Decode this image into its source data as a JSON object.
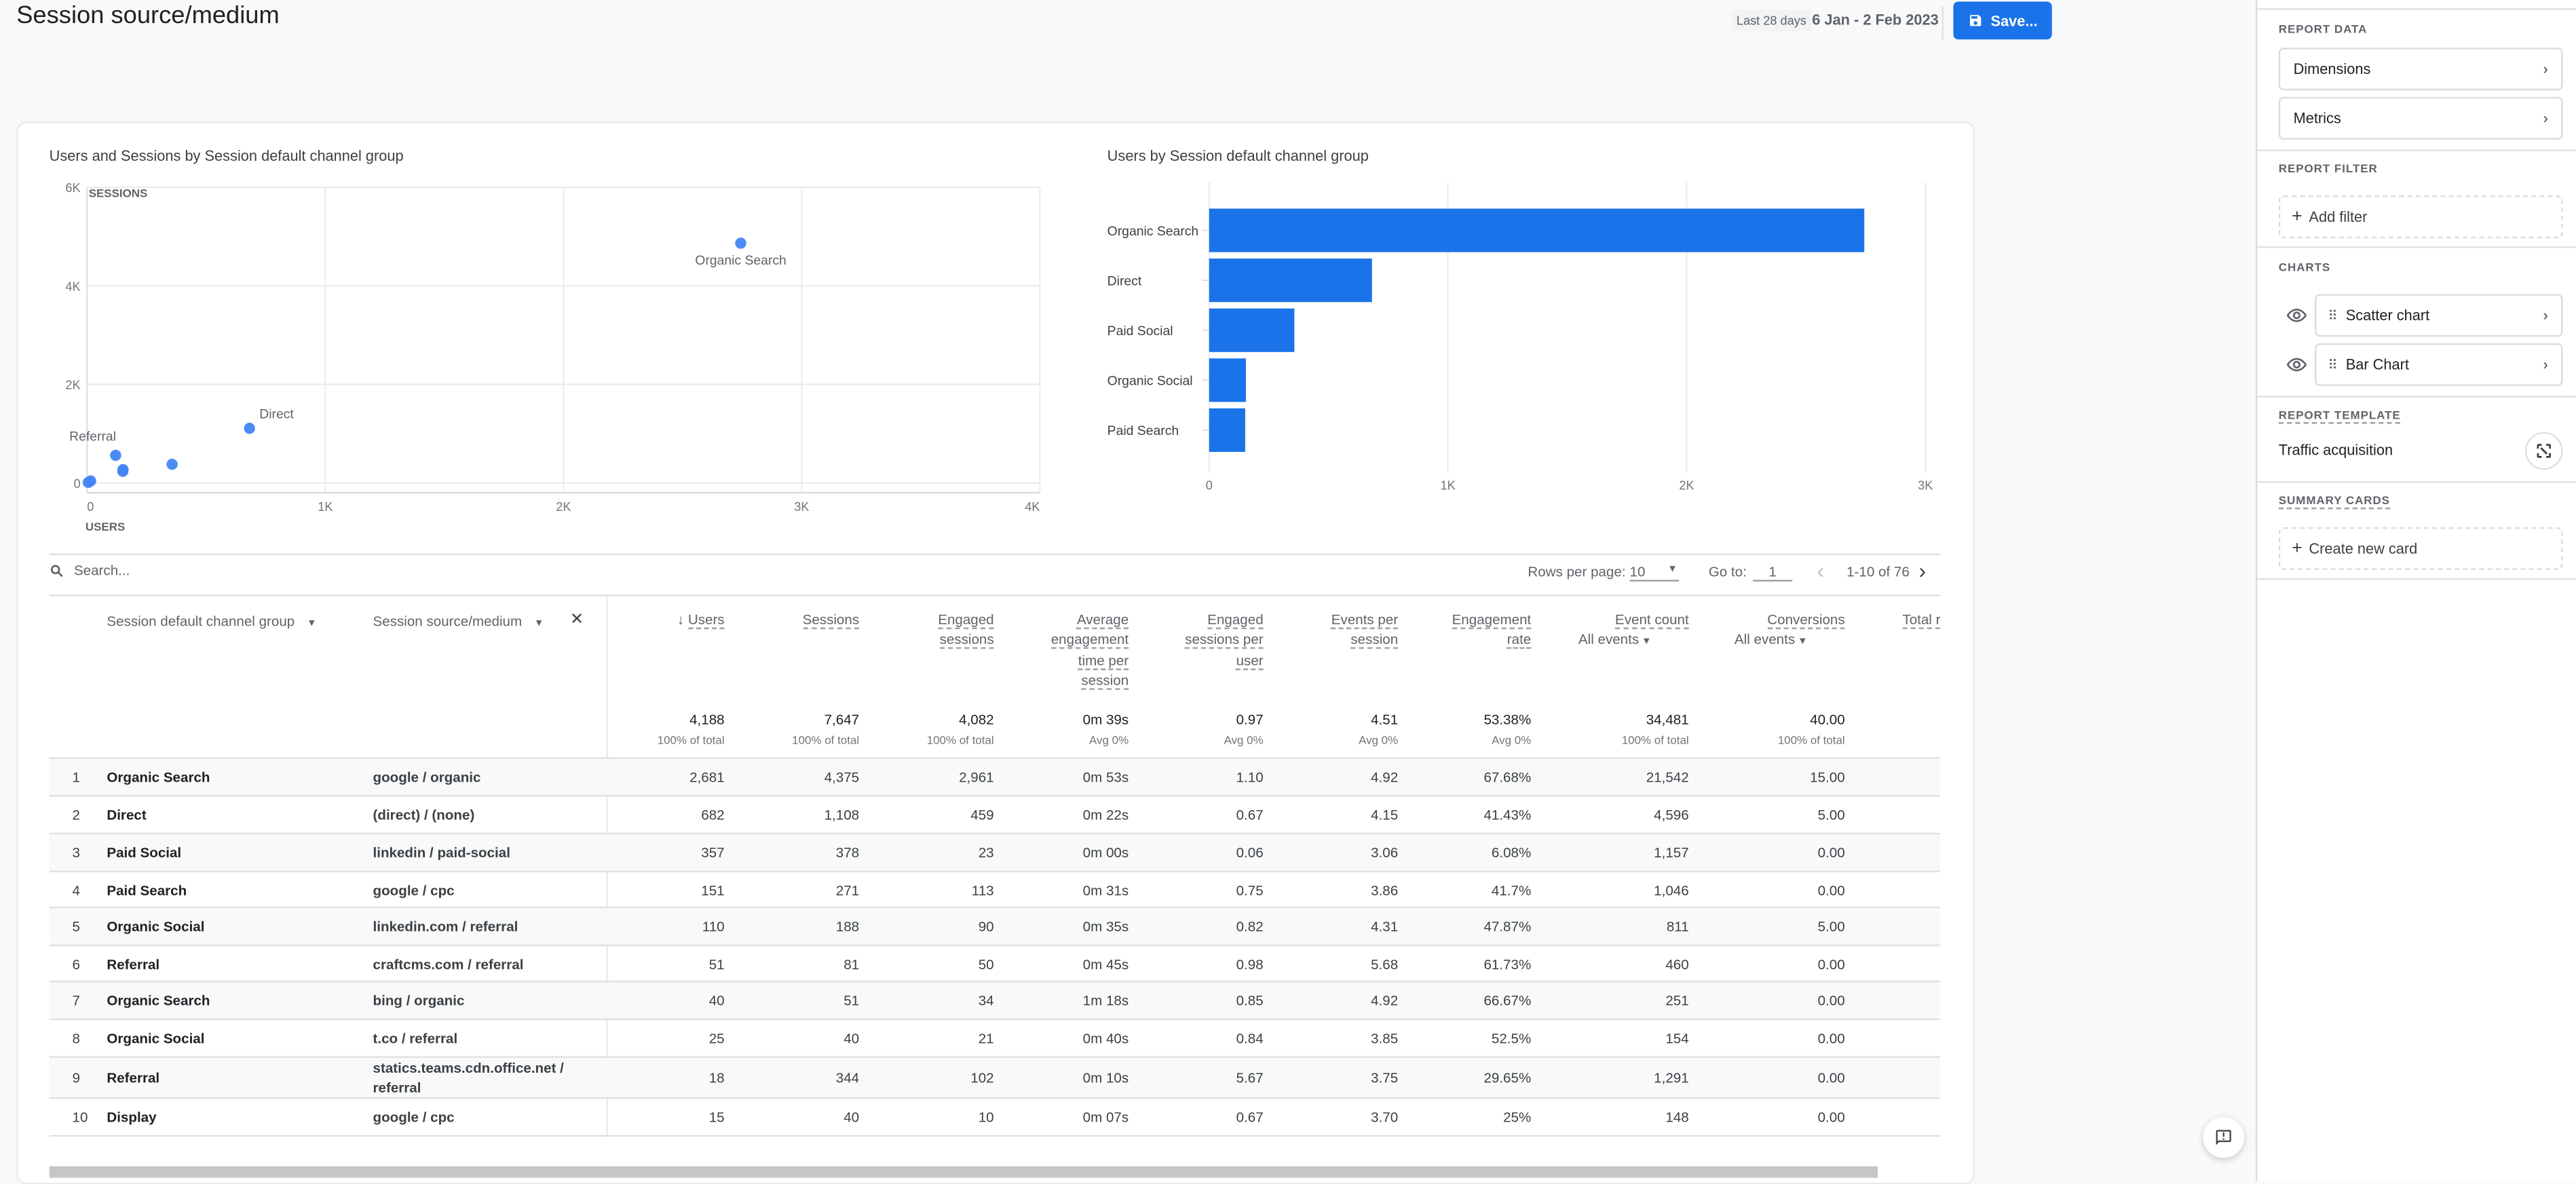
{
  "header": {
    "title": "Session source/medium",
    "date_chip": "Last 28 days",
    "date_range": "6 Jan - 2 Feb 2023",
    "save_label": "Save..."
  },
  "colors": {
    "accent": "#1a73e8",
    "point": "#4285f4"
  },
  "chart_data": [
    {
      "type": "scatter",
      "title": "Users and Sessions by Session default channel group",
      "xlabel": "USERS",
      "ylabel": "SESSIONS",
      "xlim": [
        0,
        4000
      ],
      "ylim": [
        -200,
        6000
      ],
      "x_ticks": [
        "0",
        "1K",
        "2K",
        "3K",
        "4K"
      ],
      "y_ticks": [
        "0",
        "2K",
        "4K",
        "6K"
      ],
      "grid": true,
      "points": [
        {
          "label": "Organic Search",
          "x": 2744,
          "y": 4865,
          "show_label": true
        },
        {
          "label": "Direct",
          "x": 682,
          "y": 1108,
          "show_label": true
        },
        {
          "label": "Paid Social",
          "x": 357,
          "y": 378,
          "show_label": false
        },
        {
          "label": "Referral",
          "x": 120,
          "y": 560,
          "show_label": true
        },
        {
          "label": "Organic Social",
          "x": 150,
          "y": 235,
          "show_label": false
        },
        {
          "label": "Paid Search",
          "x": 151,
          "y": 271,
          "show_label": false
        },
        {
          "label": "Display",
          "x": 15,
          "y": 40,
          "show_label": false
        },
        {
          "label": "Other",
          "x": 5,
          "y": 10,
          "show_label": false
        }
      ]
    },
    {
      "type": "bar",
      "orientation": "horizontal",
      "title": "Users by Session default channel group",
      "categories": [
        "Organic Search",
        "Direct",
        "Paid Social",
        "Organic Social",
        "Paid Search"
      ],
      "values": [
        2744,
        682,
        357,
        154,
        151
      ],
      "xlim": [
        0,
        3000
      ],
      "x_ticks": [
        "0",
        "1K",
        "2K",
        "3K"
      ],
      "grid": true
    }
  ],
  "table": {
    "search_placeholder": "Search...",
    "rows_per_page_label": "Rows per page:",
    "rows_per_page": "10",
    "goto_label": "Go to:",
    "goto_value": "1",
    "range": "1-10 of 76",
    "dim_headers": [
      "Session default channel group",
      "Session source/medium"
    ],
    "metric_headers": [
      {
        "lines": [
          "Users"
        ],
        "sorted": true
      },
      {
        "lines": [
          "Sessions"
        ]
      },
      {
        "lines": [
          "Engaged",
          "sessions"
        ]
      },
      {
        "lines": [
          "Average",
          "engagement",
          "time per",
          "session"
        ]
      },
      {
        "lines": [
          "Engaged",
          "sessions per",
          "user"
        ]
      },
      {
        "lines": [
          "Events per",
          "session"
        ]
      },
      {
        "lines": [
          "Engagement",
          "rate"
        ]
      },
      {
        "lines": [
          "Event count"
        ],
        "dropdown": "All events"
      },
      {
        "lines": [
          "Conversions"
        ],
        "dropdown": "All events"
      },
      {
        "lines": [
          "Total r"
        ]
      }
    ],
    "totals": [
      {
        "value": "4,188",
        "sub": "100% of total"
      },
      {
        "value": "7,647",
        "sub": "100% of total"
      },
      {
        "value": "4,082",
        "sub": "100% of total"
      },
      {
        "value": "0m 39s",
        "sub": "Avg 0%"
      },
      {
        "value": "0.97",
        "sub": "Avg 0%"
      },
      {
        "value": "4.51",
        "sub": "Avg 0%"
      },
      {
        "value": "53.38%",
        "sub": "Avg 0%"
      },
      {
        "value": "34,481",
        "sub": "100% of total"
      },
      {
        "value": "40.00",
        "sub": "100% of total"
      }
    ],
    "rows": [
      {
        "idx": "1",
        "channel": "Organic Search",
        "source": "google / organic",
        "values": [
          "2,681",
          "4,375",
          "2,961",
          "0m 53s",
          "1.10",
          "4.92",
          "67.68%",
          "21,542",
          "15.00"
        ]
      },
      {
        "idx": "2",
        "channel": "Direct",
        "source": "(direct) / (none)",
        "values": [
          "682",
          "1,108",
          "459",
          "0m 22s",
          "0.67",
          "4.15",
          "41.43%",
          "4,596",
          "5.00"
        ]
      },
      {
        "idx": "3",
        "channel": "Paid Social",
        "source": "linkedin / paid-social",
        "values": [
          "357",
          "378",
          "23",
          "0m 00s",
          "0.06",
          "3.06",
          "6.08%",
          "1,157",
          "0.00"
        ]
      },
      {
        "idx": "4",
        "channel": "Paid Search",
        "source": "google / cpc",
        "values": [
          "151",
          "271",
          "113",
          "0m 31s",
          "0.75",
          "3.86",
          "41.7%",
          "1,046",
          "0.00"
        ]
      },
      {
        "idx": "5",
        "channel": "Organic Social",
        "source": "linkedin.com / referral",
        "values": [
          "110",
          "188",
          "90",
          "0m 35s",
          "0.82",
          "4.31",
          "47.87%",
          "811",
          "5.00"
        ]
      },
      {
        "idx": "6",
        "channel": "Referral",
        "source": "craftcms.com / referral",
        "values": [
          "51",
          "81",
          "50",
          "0m 45s",
          "0.98",
          "5.68",
          "61.73%",
          "460",
          "0.00"
        ]
      },
      {
        "idx": "7",
        "channel": "Organic Search",
        "source": "bing / organic",
        "values": [
          "40",
          "51",
          "34",
          "1m 18s",
          "0.85",
          "4.92",
          "66.67%",
          "251",
          "0.00"
        ]
      },
      {
        "idx": "8",
        "channel": "Organic Social",
        "source": "t.co / referral",
        "values": [
          "25",
          "40",
          "21",
          "0m 40s",
          "0.84",
          "3.85",
          "52.5%",
          "154",
          "0.00"
        ]
      },
      {
        "idx": "9",
        "channel": "Referral",
        "source": "statics.teams.cdn.office.net / referral",
        "values": [
          "18",
          "344",
          "102",
          "0m 10s",
          "5.67",
          "3.75",
          "29.65%",
          "1,291",
          "0.00"
        ]
      },
      {
        "idx": "10",
        "channel": "Display",
        "source": "google / cpc",
        "values": [
          "15",
          "40",
          "10",
          "0m 07s",
          "0.67",
          "3.70",
          "25%",
          "148",
          "0.00"
        ]
      }
    ]
  },
  "sidebar": {
    "report_data_label": "REPORT DATA",
    "dimensions_label": "Dimensions",
    "metrics_label": "Metrics",
    "report_filter_label": "REPORT FILTER",
    "add_filter_label": "Add filter",
    "charts_label": "CHARTS",
    "charts": [
      {
        "label": "Scatter chart",
        "icon": "eye-icon"
      },
      {
        "label": "Bar Chart",
        "icon": "eye-icon"
      }
    ],
    "report_template_label": "REPORT TEMPLATE",
    "template_name": "Traffic acquisition",
    "summary_cards_label": "SUMMARY CARDS",
    "create_card_label": "Create new card"
  }
}
